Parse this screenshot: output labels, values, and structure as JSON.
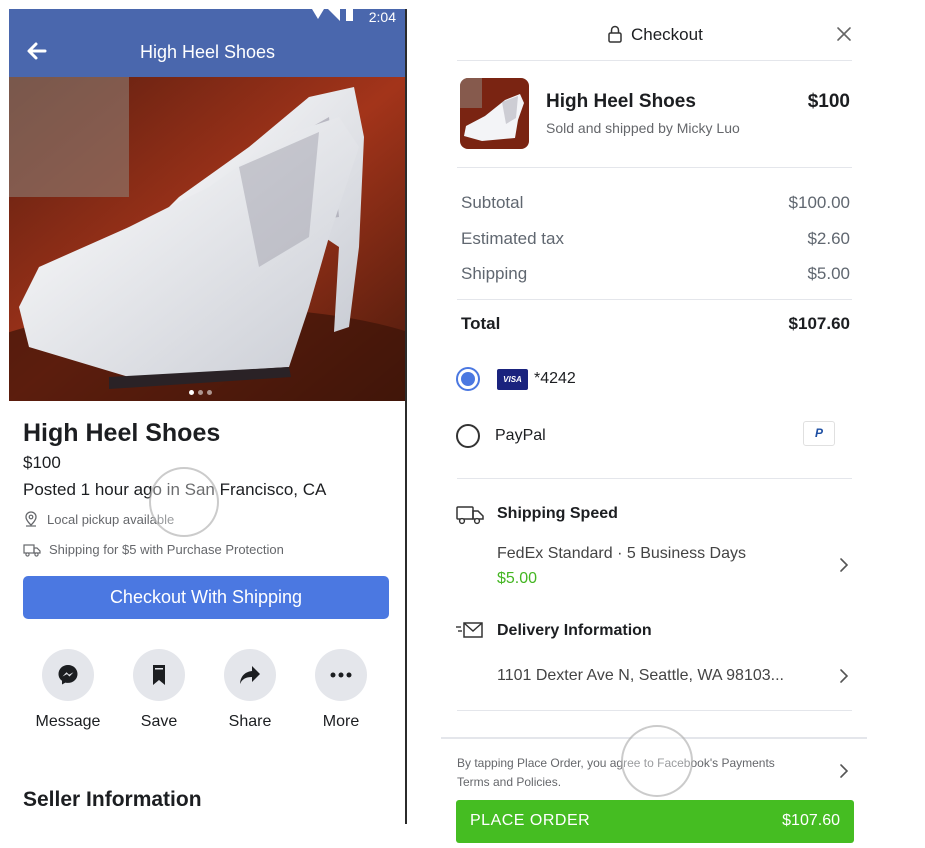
{
  "listing": {
    "status_time": "2:04",
    "header_title": "High Heel Shoes",
    "title": "High Heel Shoes",
    "price": "$100",
    "posted": "Posted 1 hour ago in San Francisco, CA",
    "pickup": "Local pickup available",
    "shipping_note": "Shipping for $5 with Purchase Protection",
    "checkout_button": "Checkout With Shipping",
    "actions": {
      "message": "Message",
      "save": "Save",
      "share": "Share",
      "more": "More"
    },
    "seller_section": "Seller Information",
    "photo_dots": 3,
    "photo_active_dot": 1
  },
  "checkout": {
    "title": "Checkout",
    "item": {
      "name": "High Heel Shoes",
      "seller": "Sold and shipped by Micky Luo",
      "price": "$100"
    },
    "summary": {
      "subtotal_label": "Subtotal",
      "subtotal_value": "$100.00",
      "tax_label": "Estimated tax",
      "tax_value": "$2.60",
      "shipping_label": "Shipping",
      "shipping_value": "$5.00",
      "total_label": "Total",
      "total_value": "$107.60"
    },
    "payment": {
      "card_brand": "VISA",
      "card_number": "*4242",
      "paypal_label": "PayPal",
      "paypal_logo": "P",
      "selected": "card"
    },
    "shipping": {
      "title": "Shipping Speed",
      "method": "FedEx Standard · 5 Business Days",
      "cost": "$5.00"
    },
    "delivery": {
      "title": "Delivery Information",
      "address": "1101 Dexter Ave N, Seattle, WA 98103..."
    },
    "terms": "By tapping Place Order, you agree to Facebook's Payments Terms and Policies.",
    "place_order_label": "PLACE ORDER",
    "place_order_price": "$107.60"
  },
  "colors": {
    "header_blue": "#4a67ad",
    "button_blue": "#4b78e1",
    "place_order_green": "#45bd22",
    "price_green": "#44b622"
  },
  "icons": {
    "back": "arrow-left-icon",
    "pickup": "location-pin-icon",
    "shipping": "truck-icon",
    "message": "messenger-icon",
    "save": "bookmark-icon",
    "share": "share-arrow-icon",
    "more": "more-dots-icon",
    "lock": "lock-icon",
    "close": "close-icon",
    "delivery": "envelope-icon",
    "chevron": "chevron-right-icon"
  }
}
